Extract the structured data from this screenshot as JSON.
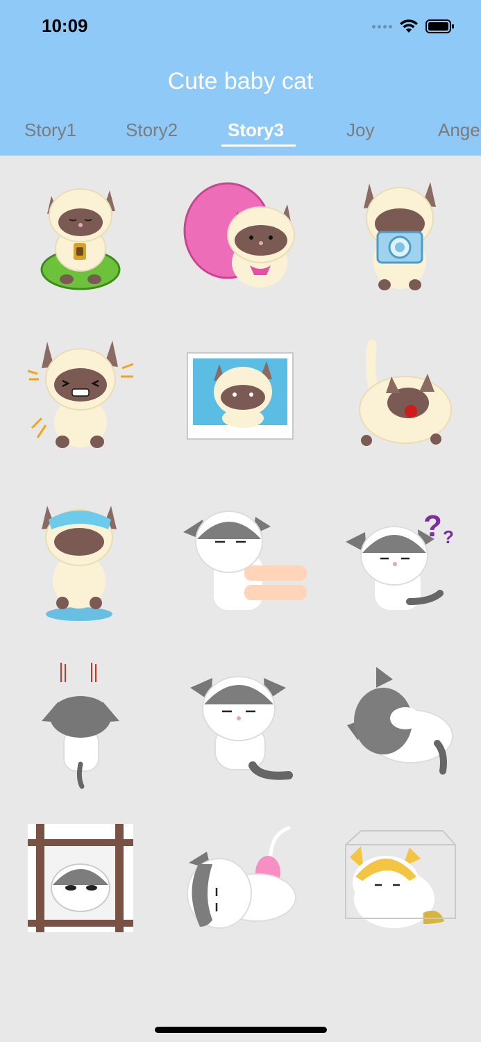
{
  "status_bar": {
    "time": "10:09"
  },
  "header": {
    "title": "Cute baby cat"
  },
  "tabs": [
    {
      "label": "Story1",
      "active": false
    },
    {
      "label": "Story2",
      "active": false
    },
    {
      "label": "Story3",
      "active": true
    },
    {
      "label": "Joy",
      "active": false
    },
    {
      "label": "Ange",
      "active": false
    }
  ],
  "colors": {
    "header_bg": "#8fc9f7",
    "page_bg": "#e8e8e8",
    "tab_inactive": "#7b7b7b",
    "tab_active": "#ffffff"
  },
  "stickers": [
    {
      "name": "siamese cat drinking tea on green cushion",
      "icon": "siamese-tea-icon"
    },
    {
      "name": "siamese cat with pink bag",
      "icon": "siamese-pink-bag-icon"
    },
    {
      "name": "siamese cat with camera",
      "icon": "siamese-camera-icon"
    },
    {
      "name": "siamese cat laughing",
      "icon": "siamese-laughing-icon"
    },
    {
      "name": "siamese cat photo frame",
      "icon": "siamese-photo-icon"
    },
    {
      "name": "siamese cat fluffy crying",
      "icon": "siamese-fluffy-icon"
    },
    {
      "name": "siamese cat with water on head",
      "icon": "siamese-wet-icon"
    },
    {
      "name": "gray cat being pushed by hand",
      "icon": "gray-cat-pushed-icon"
    },
    {
      "name": "gray cat confused with question marks",
      "icon": "gray-cat-question-icon"
    },
    {
      "name": "gray cat back view shocked",
      "icon": "gray-cat-back-icon"
    },
    {
      "name": "gray cat sitting annoyed",
      "icon": "gray-cat-annoyed-icon"
    },
    {
      "name": "gray cat hiding face",
      "icon": "gray-cat-hiding-icon"
    },
    {
      "name": "gray cat behind window bars",
      "icon": "gray-cat-window-icon"
    },
    {
      "name": "gray cat lying with pink brush",
      "icon": "gray-cat-lying-icon"
    },
    {
      "name": "yellow cat in glass box",
      "icon": "yellow-cat-box-icon"
    }
  ]
}
